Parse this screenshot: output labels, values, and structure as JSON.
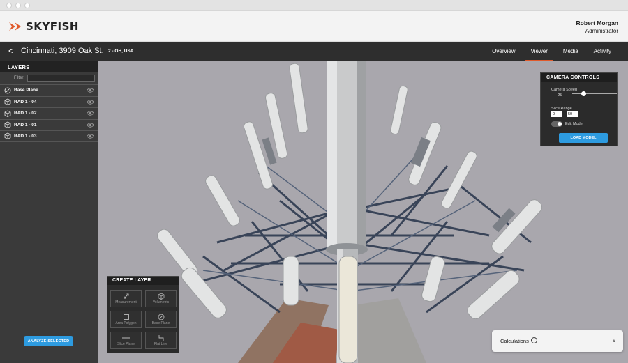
{
  "header": {
    "logo_text": "SKYFISH",
    "user_name": "Robert Morgan",
    "user_role": "Administrator"
  },
  "location": {
    "title": "Cincinnati, 3909 Oak St.",
    "subtitle": "2 - OH, USA"
  },
  "tabs": [
    {
      "label": "Overview"
    },
    {
      "label": "Viewer"
    },
    {
      "label": "Media"
    },
    {
      "label": "Activity"
    }
  ],
  "active_tab": "Viewer",
  "sidebar": {
    "title": "LAYERS",
    "filter_label": "Filter:",
    "filter_value": "",
    "layers": [
      {
        "label": "Base Plane",
        "icon": "base-plane-icon"
      },
      {
        "label": "RAD 1 - 04",
        "icon": "cube-icon"
      },
      {
        "label": "RAD 1 - 02",
        "icon": "cube-icon"
      },
      {
        "label": "RAD 1 - 01",
        "icon": "cube-icon"
      },
      {
        "label": "RAD 1 - 03",
        "icon": "cube-icon"
      }
    ],
    "analyze_label": "ANALYZE SELECTED"
  },
  "camera_controls": {
    "title": "CAMERA CONTROLS",
    "speed_label": "Camera Speed",
    "speed_value": "25",
    "speed_fraction": 0.25,
    "slice_label": "Slice Range",
    "slice_min": "0",
    "slice_max": "50",
    "edit_mode_label": "Edit Mode",
    "load_label": "LOAD MODEL"
  },
  "create_layer": {
    "title": "CREATE LAYER",
    "tools": [
      {
        "label": "Measurement",
        "icon": "measure-icon"
      },
      {
        "label": "Volumetric",
        "icon": "cube-icon"
      },
      {
        "label": "Area Polygon",
        "icon": "polygon-icon"
      },
      {
        "label": "Base Plane",
        "icon": "base-plane-icon"
      },
      {
        "label": "Slice Plane",
        "icon": "slice-icon"
      },
      {
        "label": "Flat Line",
        "icon": "flat-line-icon"
      }
    ]
  },
  "calculations": {
    "label": "Calculations",
    "info": "i",
    "chevron": "∨"
  },
  "colors": {
    "accent_blue": "#2d9be0",
    "active_tab_underline": "#e05a2b",
    "logo_mark": "#e05a2b"
  }
}
